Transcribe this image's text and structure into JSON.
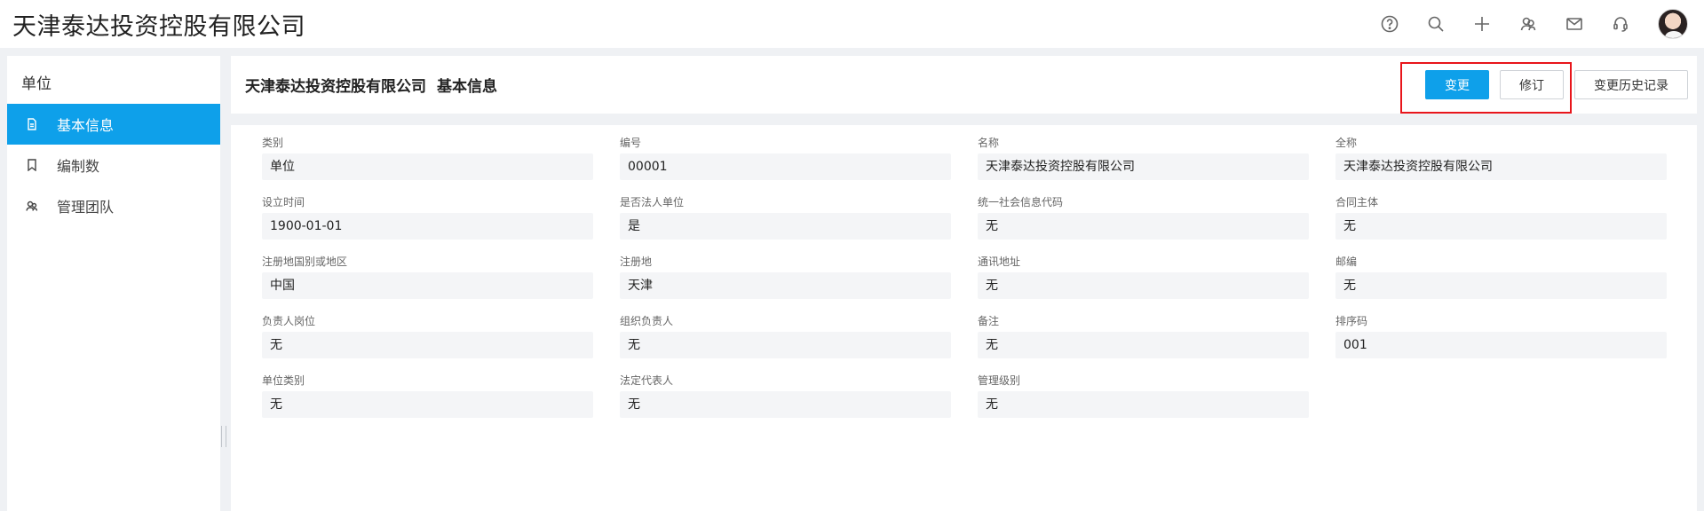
{
  "header": {
    "company": "天津泰达投资控股有限公司",
    "icons": [
      "help-icon",
      "search-icon",
      "plus-icon",
      "team-icon",
      "mail-icon",
      "headset-icon"
    ]
  },
  "sidebar": {
    "title": "单位",
    "items": [
      {
        "label": "基本信息",
        "icon": "document-icon",
        "active": true
      },
      {
        "label": "编制数",
        "icon": "bookmark-icon",
        "active": false
      },
      {
        "label": "管理团队",
        "icon": "team-icon",
        "active": false
      }
    ]
  },
  "main": {
    "company": "天津泰达投资控股有限公司",
    "section": "基本信息",
    "buttons": {
      "change": "变更",
      "revise": "修订",
      "history": "变更历史记录"
    }
  },
  "fields": [
    {
      "label": "类别",
      "value": "单位"
    },
    {
      "label": "编号",
      "value": "00001"
    },
    {
      "label": "名称",
      "value": "天津泰达投资控股有限公司"
    },
    {
      "label": "全称",
      "value": "天津泰达投资控股有限公司"
    },
    {
      "label": "设立时间",
      "value": "1900-01-01"
    },
    {
      "label": "是否法人单位",
      "value": "是"
    },
    {
      "label": "统一社会信息代码",
      "value": "无"
    },
    {
      "label": "合同主体",
      "value": "无"
    },
    {
      "label": "注册地国别或地区",
      "value": "中国"
    },
    {
      "label": "注册地",
      "value": "天津"
    },
    {
      "label": "通讯地址",
      "value": "无"
    },
    {
      "label": "邮编",
      "value": "无"
    },
    {
      "label": "负责人岗位",
      "value": "无"
    },
    {
      "label": "组织负责人",
      "value": "无"
    },
    {
      "label": "备注",
      "value": "无"
    },
    {
      "label": "排序码",
      "value": "001"
    },
    {
      "label": "单位类别",
      "value": "无"
    },
    {
      "label": "法定代表人",
      "value": "无"
    },
    {
      "label": "管理级别",
      "value": "无"
    }
  ],
  "colors": {
    "accent": "#0ea0ea",
    "highlight": "#e8151b",
    "background": "#eff1f4"
  }
}
